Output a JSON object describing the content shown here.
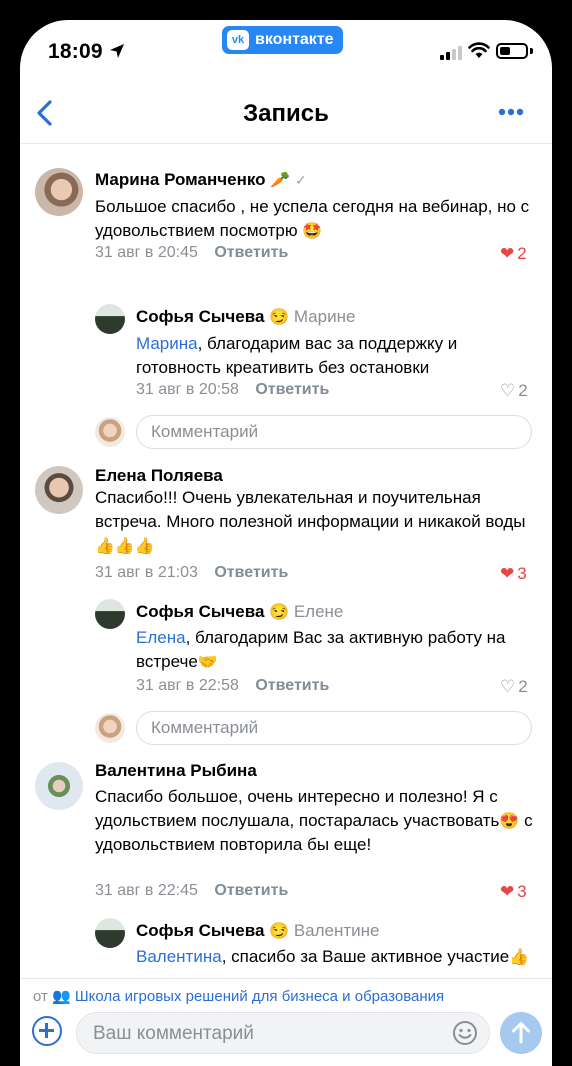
{
  "status": {
    "time": "18:09",
    "app_badge": "вконтакте",
    "app_logo": "vk"
  },
  "header": {
    "title": "Запись"
  },
  "comments": [
    {
      "name": "Марина Романченко",
      "text": "Большое спасибо , не успела сегодня на вебинар, но с удовольствием посмотрю",
      "date": "31 авг в 20:45",
      "likes": "2",
      "reply": {
        "name": "Софья Сычева",
        "to": "Марине",
        "mention": "Марина",
        "text": ", благодарим вас за поддержку и готовность креативить без остановки",
        "date": "31 авг в 20:58",
        "likes": "2"
      }
    },
    {
      "name": "Елена Поляева",
      "text": "Спасибо!!! Очень увлекательная и поучительная встреча. Много полезной информации и никакой воды",
      "date": "31 авг в 21:03",
      "likes": "3",
      "reply": {
        "name": "Софья Сычева",
        "to": "Елене",
        "mention": "Елена",
        "text": ", благодарим Вас за активную работу на встрече",
        "date": "31 авг в 22:58",
        "likes": "2"
      }
    },
    {
      "name": "Валентина Рыбина",
      "text": "Спасибо большое, очень интересно и полезно! Я с удольствием послушала, постаралась участвовать",
      "text2": " с удовольствием повторила бы еще!",
      "date": "31 авг в 22:45",
      "likes": "3",
      "reply": {
        "name": "Софья Сычева",
        "to": "Валентине",
        "mention": "Валентина",
        "text": ", спасибо за Ваше активное участие"
      }
    }
  ],
  "labels": {
    "reply": "Ответить",
    "comment_placeholder": "Комментарий"
  },
  "source": {
    "prefix": "от",
    "group": "Школа игровых решений для бизнеса и образования"
  },
  "composer": {
    "placeholder": "Ваш комментарий"
  },
  "colors": {
    "accent": "#2a6fd6",
    "like_active": "#e64646",
    "vk_blue": "#2787f5",
    "muted": "#8a8f96"
  }
}
